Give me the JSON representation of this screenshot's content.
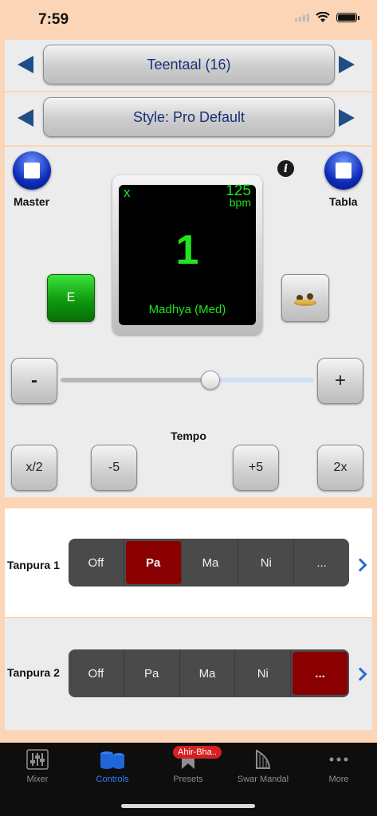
{
  "status": {
    "time": "7:59"
  },
  "rhythm": {
    "label": "Teentaal (16)"
  },
  "style": {
    "label": "Style: Pro Default"
  },
  "master": {
    "label": "Master"
  },
  "tabla": {
    "label": "Tabla"
  },
  "display": {
    "indicator": "x",
    "bpm_value": "125",
    "bpm_unit": "bpm",
    "beat": "1",
    "laya": "Madhya (Med)"
  },
  "e_button": {
    "label": "E"
  },
  "tempo": {
    "label": "Tempo",
    "minus": "-",
    "plus": "+",
    "half": "x/2",
    "minus5": "-5",
    "plus5": "+5",
    "double": "2x",
    "slider_fraction": 0.59
  },
  "tanpura1": {
    "label": "Tanpura 1",
    "options": [
      "Off",
      "Pa",
      "Ma",
      "Ni",
      "..."
    ],
    "selected": 1
  },
  "tanpura2": {
    "label": "Tanpura 2",
    "options": [
      "Off",
      "Pa",
      "Ma",
      "Ni",
      "..."
    ],
    "selected": 4
  },
  "tabs": [
    {
      "label": "Mixer",
      "icon": "mixer-icon"
    },
    {
      "label": "Controls",
      "icon": "tabla-drums-icon",
      "active": true
    },
    {
      "label": "Presets",
      "icon": "bookmark-icon",
      "badge": "Ahir-Bha.."
    },
    {
      "label": "Swar Mandal",
      "icon": "harp-icon"
    },
    {
      "label": "More",
      "icon": "more-dots-icon"
    }
  ],
  "colors": {
    "background": "#fbd5b5",
    "accent": "#2f80ff",
    "selected_segment": "#8a0000",
    "display_text": "#1ee51e"
  }
}
